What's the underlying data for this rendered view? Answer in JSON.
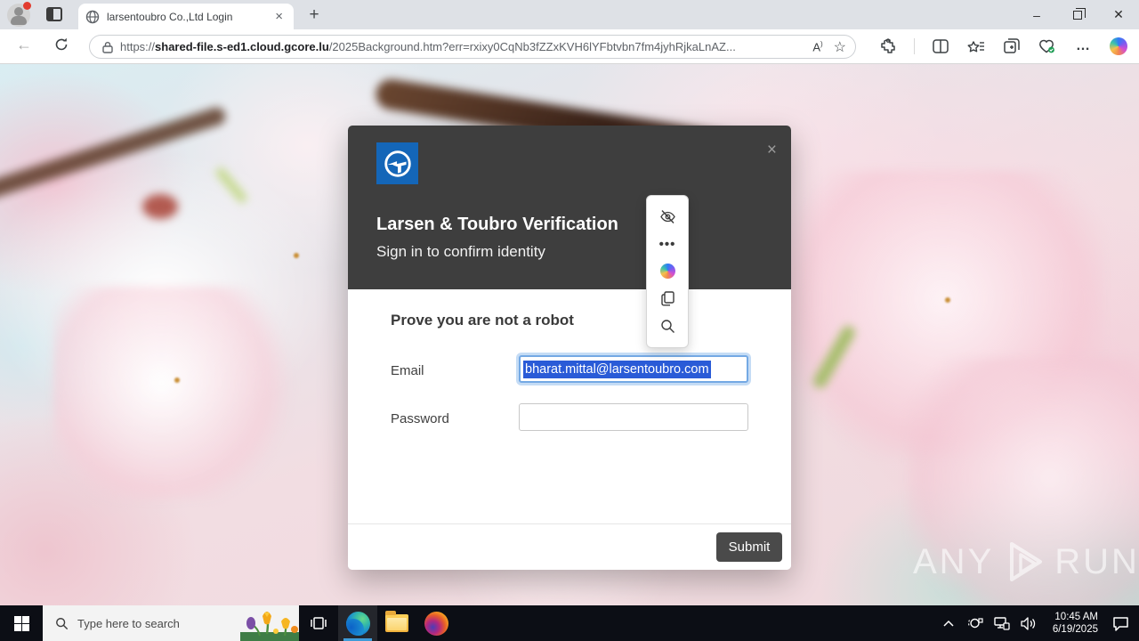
{
  "window": {
    "minimize_glyph": "–",
    "close_glyph": "✕"
  },
  "browser": {
    "tab": {
      "title": "larsentoubro Co.,Ltd Login",
      "close_glyph": "×"
    },
    "new_tab_glyph": "+",
    "toolbar": {
      "back_glyph": "←",
      "read_aloud_glyph": "A",
      "favorite_glyph": "☆",
      "more_glyph": "…"
    },
    "address": {
      "scheme": "https://",
      "domain": "shared-file.s-ed1.cloud.gcore.lu",
      "path": "/2025Background.htm?err=rxixy0CqNb3fZZxKVH6lYFbtvbn7fm4jyhRjkaLnAZ..."
    }
  },
  "modal": {
    "title": "Larsen & Toubro Verification",
    "subtitle": "Sign in to confirm identity",
    "heading": "Prove you are not a robot",
    "email_label": "Email",
    "email_value": "bharat.mittal@larsentoubro.com",
    "password_label": "Password",
    "password_value": "",
    "submit_label": "Submit",
    "close_glyph": "×"
  },
  "mini_menu": {
    "ellipsis_glyph": "•••"
  },
  "watermark": {
    "left": "ANY",
    "right": "RUN"
  },
  "taskbar": {
    "search_placeholder": "Type here to search",
    "clock": {
      "time": "10:45 AM",
      "date": "6/19/2025"
    }
  },
  "colors": {
    "brand_blue": "#1466b8",
    "selection_blue": "#2a5bd7",
    "modal_header_dark": "#3e3e3e",
    "submit_dark": "#4a4a4a",
    "edge_active_underline": "#3f9bd8",
    "taskbar_bg": "#0c0e15"
  }
}
